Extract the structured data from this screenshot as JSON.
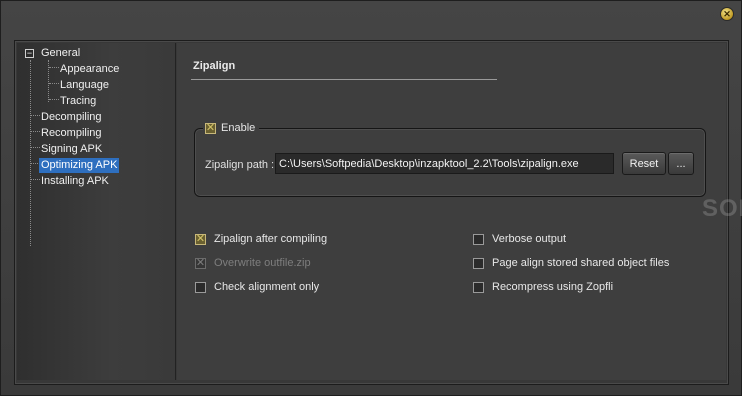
{
  "tree": {
    "root_label": "General",
    "expander_symbol": "−",
    "children": [
      "Appearance",
      "Language",
      "Tracing"
    ],
    "items": [
      "Decompiling",
      "Recompiling",
      "Signing APK",
      "Optimizing APK",
      "Installing APK"
    ],
    "selected": "Optimizing APK"
  },
  "section": {
    "title": "Zipalign"
  },
  "enable": {
    "label": "Enable",
    "checked": true,
    "mark": "✕"
  },
  "zipalign_path": {
    "label": "Zipalign path :",
    "value": "C:\\Users\\Softpedia\\Desktop\\inzapktool_2.2\\Tools\\zipalign.exe",
    "reset_label": "Reset",
    "browse_label": "..."
  },
  "options": {
    "zipalign_after_compiling": {
      "label": "Zipalign after compiling",
      "checked": true,
      "mark": "✕"
    },
    "overwrite_outfile": {
      "label": "Overwrite outfile.zip",
      "checked": true,
      "disabled": true,
      "mark": "✕"
    },
    "check_alignment_only": {
      "label": "Check alignment only",
      "checked": false
    },
    "verbose_output": {
      "label": "Verbose output",
      "checked": false
    },
    "page_align": {
      "label": "Page align stored shared object files",
      "checked": false
    },
    "recompress_zopfli": {
      "label": "Recompress using Zopfli",
      "checked": false
    }
  },
  "watermark": "SOFTPEDIA",
  "close_symbol": "✕",
  "colors": {
    "selection": "#2e6fbf",
    "check_accent": "#d4c46a"
  }
}
